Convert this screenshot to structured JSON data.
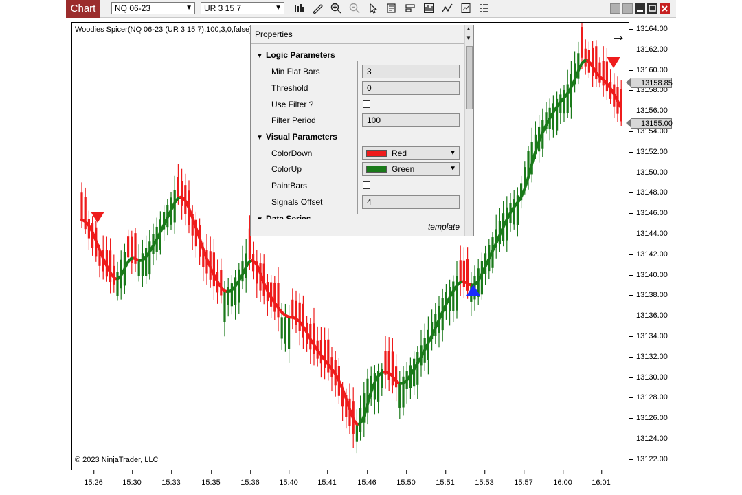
{
  "toolbar": {
    "tab_label": "Chart",
    "instrument": "NQ 06-23",
    "bar_type": "UR 3 15 7",
    "icons": [
      "bars-type-icon",
      "draw-icon",
      "zoom-in-icon",
      "zoom-out-icon",
      "pointer-icon",
      "data-box-icon",
      "templates-icon",
      "chart-trader-icon",
      "indicators-icon",
      "strategies-icon",
      "properties-icon"
    ]
  },
  "chart": {
    "indicator_label": "Woodies Spicer(NQ 06-23 (UR 3 15 7),100,3,0,false)",
    "copyright": "© 2023 NinjaTrader, LLC",
    "price_ticks": [
      "13164.00",
      "13162.00",
      "13160.00",
      "13158.00",
      "13156.00",
      "13154.00",
      "13152.00",
      "13150.00",
      "13148.00",
      "13146.00",
      "13144.00",
      "13142.00",
      "13140.00",
      "13138.00",
      "13136.00",
      "13134.00",
      "13132.00",
      "13130.00",
      "13128.00",
      "13126.00",
      "13124.00",
      "13122.00"
    ],
    "price_tags": [
      "13158.85",
      "13155.00"
    ],
    "time_ticks": [
      "15:26",
      "15:30",
      "15:33",
      "15:35",
      "15:36",
      "15:40",
      "15:41",
      "15:46",
      "15:50",
      "15:51",
      "15:53",
      "15:57",
      "16:00",
      "16:01"
    ],
    "colors": {
      "up": "#1a7a1a",
      "down": "#ee1c1c",
      "signal_up": "#1a2bff",
      "signal_down": "#ee1c1c"
    }
  },
  "properties": {
    "title": "Properties",
    "sections": [
      {
        "title": "Logic Parameters",
        "items": [
          {
            "label": "Min Flat Bars",
            "value": "3"
          },
          {
            "label": "Threshold",
            "value": "0"
          },
          {
            "label": "Use Filter ?",
            "value": ""
          },
          {
            "label": "Filter Period",
            "value": "100"
          }
        ]
      },
      {
        "title": "Visual Parameters",
        "items": [
          {
            "label": "ColorDown",
            "value": "Red",
            "swatch": "#ee1c1c"
          },
          {
            "label": "ColorUp",
            "value": "Green",
            "swatch": "#1a7a1a"
          },
          {
            "label": "PaintBars",
            "value": ""
          },
          {
            "label": "Signals Offset",
            "value": "4"
          }
        ]
      },
      {
        "title": "Data Series"
      }
    ],
    "footer": "template"
  }
}
